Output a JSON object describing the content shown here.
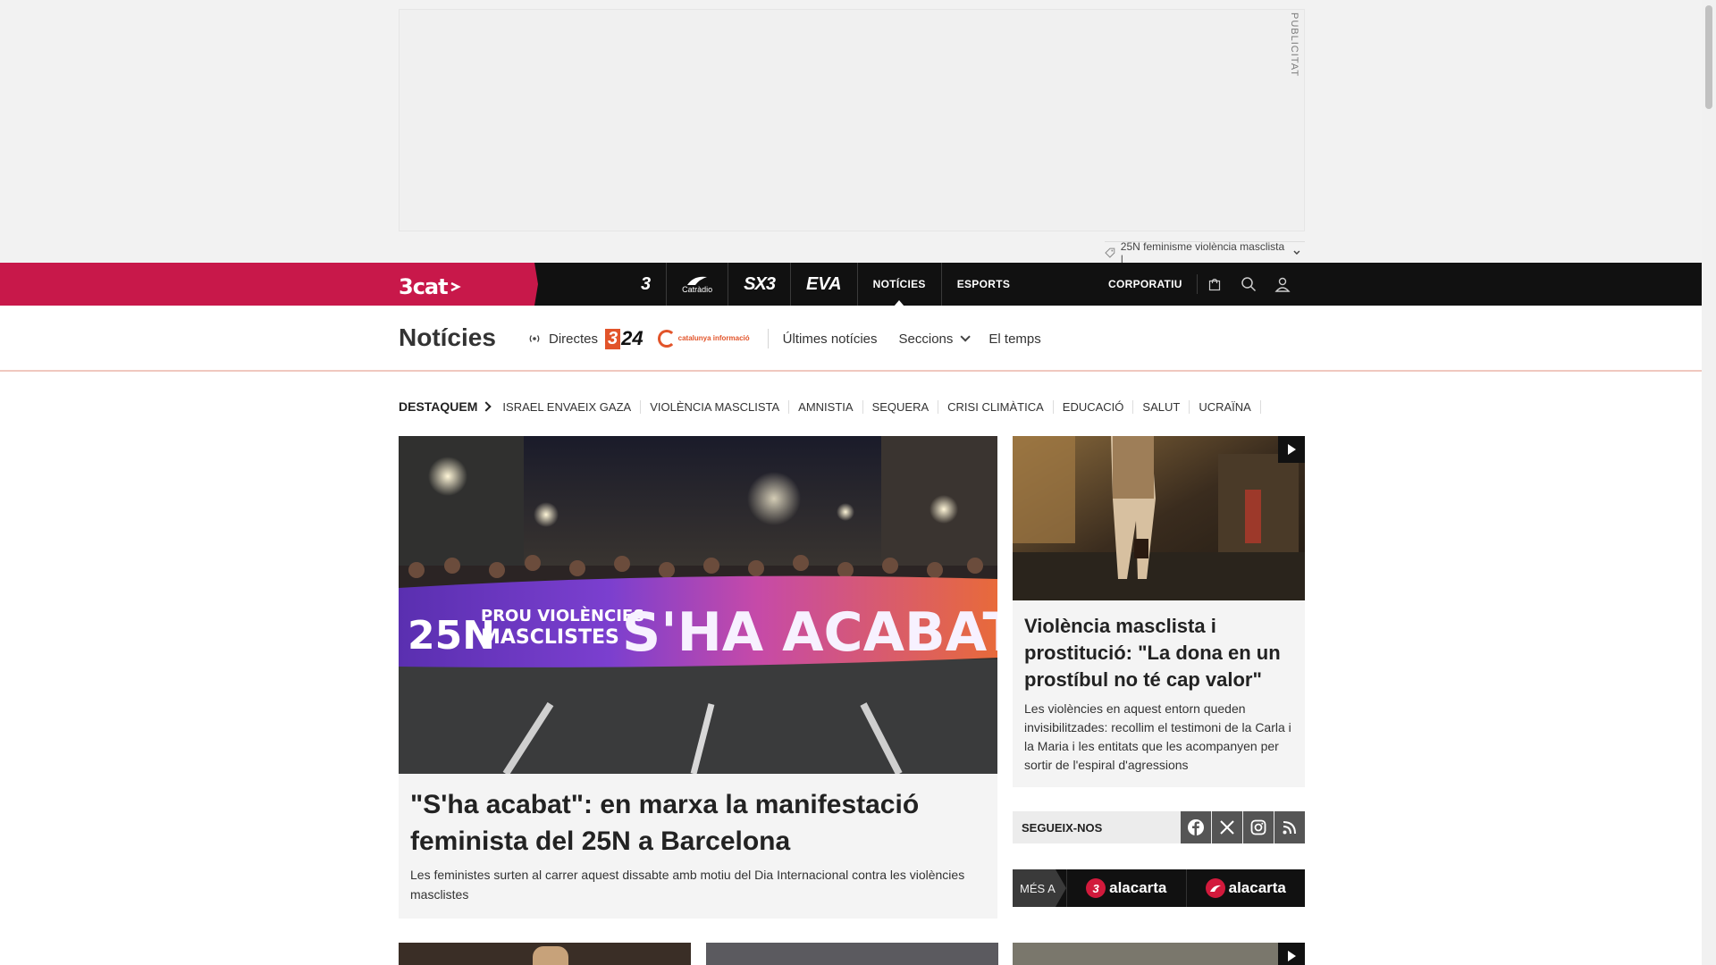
{
  "ad": {
    "label": "PUBLICITAT"
  },
  "tagline": {
    "text": "25N feminisme violència masclista |"
  },
  "topnav": {
    "brand": "3cat",
    "channels": [
      {
        "name": "tv3",
        "label": "3"
      },
      {
        "name": "catradio",
        "label": "Catràdio"
      },
      {
        "name": "sx3",
        "label": "SX3"
      },
      {
        "name": "eva",
        "label": "EVA"
      },
      {
        "name": "noticies",
        "label": "NOTÍCIES"
      },
      {
        "name": "esports",
        "label": "ESPORTS"
      }
    ],
    "corporate": "CORPORATIU"
  },
  "section": {
    "title": "Notícies",
    "directes": "Directes",
    "logo_324": "24",
    "logo_ci": "catalunya informació",
    "menu": [
      "Últimes notícies",
      "Seccions",
      "El temps"
    ]
  },
  "destaquem": {
    "label": "DESTAQUEM",
    "tags": [
      "ISRAEL ENVAEIX GAZA",
      "VIOLÈNCIA MASCLISTA",
      "AMNISTIA",
      "SEQUERA",
      "CRISI CLIMÀTICA",
      "EDUCACIÓ",
      "SALUT",
      "UCRAÏNA"
    ]
  },
  "main_story": {
    "title": "\"S'ha acabat\": en marxa la manifestació feminista del 25N a Barcelona",
    "summary": "Les feministes surten al carrer aquest dissabte amb motiu del Dia Internacional contra les violències masclistes",
    "banner_line1": "25N",
    "banner_line2": "PROU VIOLÈNCIES",
    "banner_line3": "MASCLISTES",
    "banner_big": "S'HA ACABAT!!"
  },
  "side_story": {
    "title": "Violència masclista i prostitució: \"La dona en un prostíbul no té cap valor\"",
    "summary": "Les violències en aquest entorn queden invisibilitzades: recollim el testimoni de la Carla i la Maria i les entitats que les acompanyen per sortir de l'espiral d'agressions"
  },
  "follow": {
    "label": "SEGUEIX-NOS",
    "networks": [
      "facebook-icon",
      "x-icon",
      "instagram-icon",
      "rss-icon"
    ]
  },
  "mesa": {
    "label": "MÉS A",
    "items": [
      {
        "badge": "3",
        "text": "alacarta"
      },
      {
        "badge": "",
        "text": "alacarta"
      }
    ]
  },
  "colors": {
    "brand": "#c8184a",
    "nav_bg": "#111111",
    "accent_orange": "#e2542a"
  }
}
